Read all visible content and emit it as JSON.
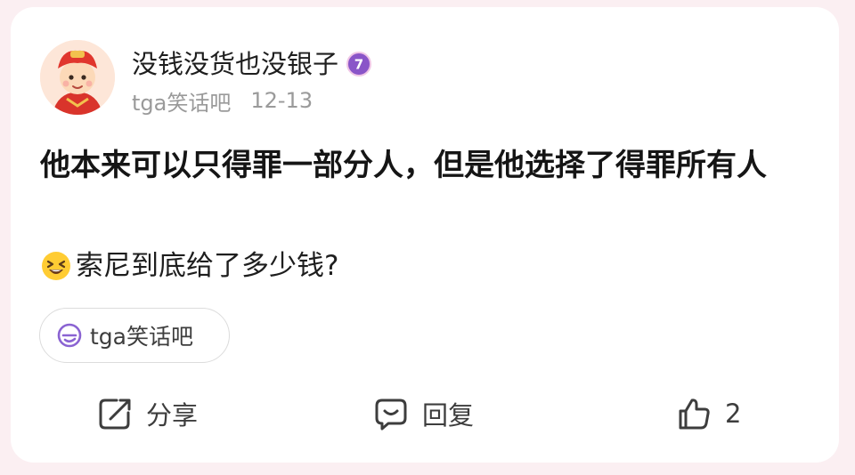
{
  "post": {
    "author": {
      "name": "没钱没货也没银子",
      "level": "7"
    },
    "forum": "tga笑话吧",
    "date": "12-13",
    "title": "他本来可以只得罪一部分人，但是他选择了得罪所有人",
    "body": "索尼到底给了多少钱?",
    "topic_tag": "tga笑话吧"
  },
  "actions": {
    "share_label": "分享",
    "reply_label": "回复",
    "like_count": "2"
  },
  "colors": {
    "background": "#fbeff2",
    "card": "#ffffff",
    "level_badge": "#8a55c8",
    "tag_icon": "#8a63d2",
    "meta_text": "#9a9a9a"
  },
  "icons": {
    "level": "level-badge-icon",
    "emoji": "grinning-squint-emoji",
    "tag": "topic-tag-icon",
    "share": "share-icon",
    "reply": "reply-icon",
    "like": "thumbs-up-icon"
  }
}
